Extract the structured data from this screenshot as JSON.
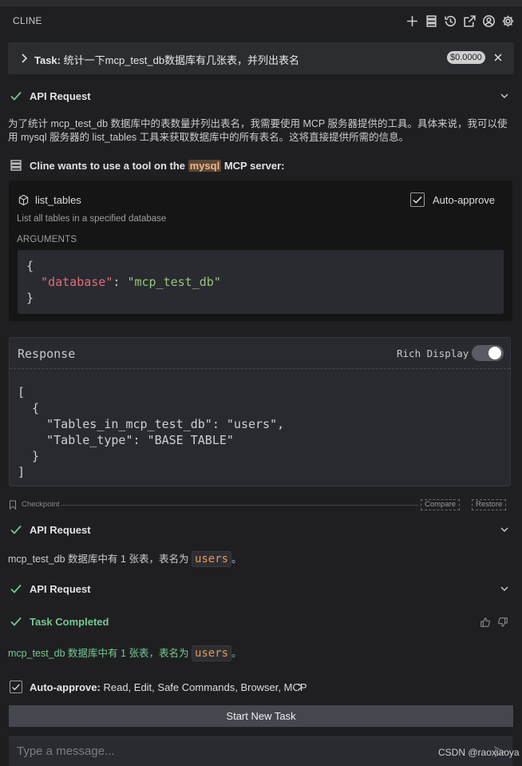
{
  "app": {
    "title": "CLINE",
    "header_icons": [
      "plus-icon",
      "server-icon",
      "history-icon",
      "popout-icon",
      "account-icon",
      "gear-icon"
    ]
  },
  "task": {
    "prefix": "Task:",
    "text": "统计一下mcp_test_db数据库有几张表，并列出表名",
    "cost": "$0.0000"
  },
  "api_request_1": {
    "label": "API Request"
  },
  "explanation": "为了统计 mcp_test_db 数据库中的表数量并列出表名，我需要使用 MCP 服务器提供的工具。具体来说，我可以使用 mysql 服务器的 list_tables 工具来获取数据库中的所有表名。这将直接提供所需的信息。",
  "tool_use": {
    "before": "Cline wants to use a tool on the",
    "server": "mysql",
    "after": "MCP server:"
  },
  "tool": {
    "name": "list_tables",
    "auto_approve_label": "Auto-approve",
    "auto_approve_checked": true,
    "description": "List all tables in a specified database",
    "arguments_label": "ARGUMENTS",
    "arg_open": "{",
    "arg_key": "\"database\"",
    "arg_colon": ": ",
    "arg_value": "\"mcp_test_db\"",
    "arg_close": "}"
  },
  "response": {
    "title": "Response",
    "rich_display_label": "Rich Display",
    "rich_display_on": true,
    "body": "[\n  {\n    \"Tables_in_mcp_test_db\": \"users\",\n    \"Table_type\": \"BASE TABLE\"\n  }\n]"
  },
  "checkpoint": {
    "label": "Checkpoint",
    "compare": "Compare",
    "restore": "Restore"
  },
  "api_request_2": {
    "label": "API Request",
    "answer_prefix": "mcp_test_db 数据库中有 1 张表，表名为",
    "answer_table": "users",
    "answer_suffix": "。"
  },
  "api_request_3": {
    "label": "API Request"
  },
  "task_completed": {
    "label": "Task Completed",
    "answer_prefix": "mcp_test_db 数据库中有 1 张表，表名为",
    "answer_table": "users",
    "answer_suffix": "。"
  },
  "auto_approve": {
    "label": "Auto-approve:",
    "items": "Read, Edit, Safe Commands, Browser, MCP",
    "checked": true
  },
  "start_new_task": "Start New Task",
  "input": {
    "placeholder": "Type a message..."
  },
  "watermark": "CSDN @raoxiaoya",
  "colors": {
    "success_green": "#73c991",
    "accent_orange": "#e69a5a",
    "json_key": "#e06c75",
    "json_string": "#98c379"
  }
}
